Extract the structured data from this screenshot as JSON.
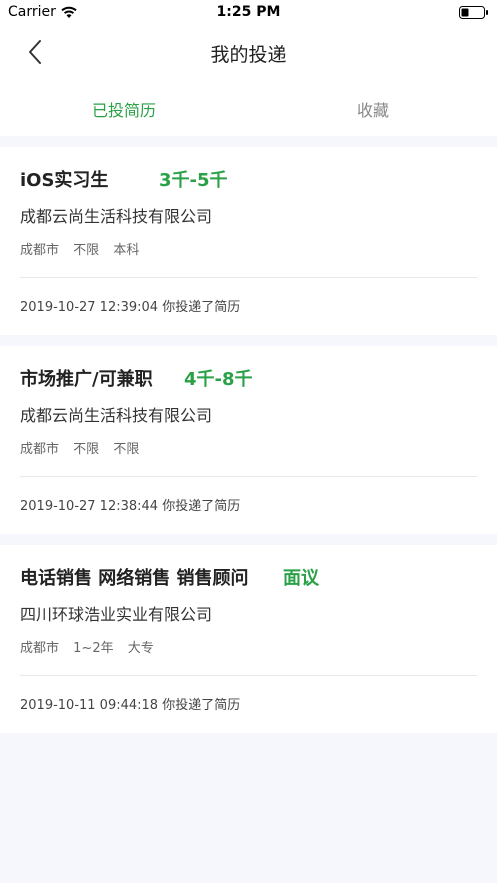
{
  "status_bar": {
    "carrier": "Carrier",
    "time": "1:25 PM",
    "icons": [
      "wifi-icon",
      "battery-icon"
    ]
  },
  "nav": {
    "title": "我的投递",
    "back_icon": "chevron-left-icon"
  },
  "tabs": [
    {
      "label": "已投简历",
      "active": true
    },
    {
      "label": "收藏",
      "active": false
    }
  ],
  "colors": {
    "accent": "#2aa147",
    "page_bg": "#f5f7fc",
    "card_bg": "#ffffff"
  },
  "applications": [
    {
      "title": "iOS实习生",
      "salary": "3千-5千",
      "company": "成都云尚生活科技有限公司",
      "tags": [
        "成都市",
        "不限",
        "本科"
      ],
      "footer": "2019-10-27 12:39:04 你投递了简历"
    },
    {
      "title": "市场推广/可兼职",
      "salary": "4千-8千",
      "company": "成都云尚生活科技有限公司",
      "tags": [
        "成都市",
        "不限",
        "不限"
      ],
      "footer": "2019-10-27 12:38:44 你投递了简历"
    },
    {
      "title": "电话销售 网络销售 销售顾问",
      "salary": "面议",
      "company": "四川环球浩业实业有限公司",
      "tags": [
        "成都市",
        "1~2年",
        "大专"
      ],
      "footer": "2019-10-11 09:44:18 你投递了简历"
    }
  ]
}
